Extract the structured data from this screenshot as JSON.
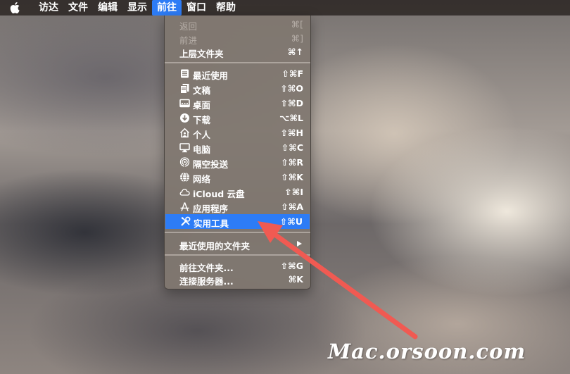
{
  "menubar": {
    "apple_icon": "apple-logo-icon",
    "items": [
      {
        "label": "访达"
      },
      {
        "label": "文件"
      },
      {
        "label": "编辑"
      },
      {
        "label": "显示"
      },
      {
        "label": "前往",
        "active": true
      },
      {
        "label": "窗口"
      },
      {
        "label": "帮助"
      }
    ]
  },
  "go_menu": {
    "back": {
      "label": "返回",
      "shortcut": "⌘["
    },
    "forward": {
      "label": "前进",
      "shortcut": "⌘]"
    },
    "enclosing": {
      "label": "上层文件夹",
      "shortcut": "⌘↑"
    },
    "recents": {
      "label": "最近使用",
      "shortcut": "⇧⌘F",
      "icon": "recents-icon"
    },
    "documents": {
      "label": "文稿",
      "shortcut": "⇧⌘O",
      "icon": "documents-icon"
    },
    "desktop": {
      "label": "桌面",
      "shortcut": "⇧⌘D",
      "icon": "desktop-icon"
    },
    "downloads": {
      "label": "下载",
      "shortcut": "⌥⌘L",
      "icon": "downloads-icon"
    },
    "home": {
      "label": "个人",
      "shortcut": "⇧⌘H",
      "icon": "home-icon"
    },
    "computer": {
      "label": "电脑",
      "shortcut": "⇧⌘C",
      "icon": "computer-icon"
    },
    "airdrop": {
      "label": "隔空投送",
      "shortcut": "⇧⌘R",
      "icon": "airdrop-icon"
    },
    "network": {
      "label": "网络",
      "shortcut": "⇧⌘K",
      "icon": "network-icon"
    },
    "icloud": {
      "label": "iCloud 云盘",
      "shortcut": "⇧⌘I",
      "icon": "cloud-icon"
    },
    "applications": {
      "label": "应用程序",
      "shortcut": "⇧⌘A",
      "icon": "applications-icon"
    },
    "utilities": {
      "label": "实用工具",
      "shortcut": "⇧⌘U",
      "icon": "utilities-icon",
      "highlighted": true
    },
    "recent_folders": {
      "label": "最近使用的文件夹"
    },
    "go_to_folder": {
      "label": "前往文件夹...",
      "shortcut": "⇧⌘G"
    },
    "connect_server": {
      "label": "连接服务器...",
      "shortcut": "⌘K"
    }
  },
  "watermark": {
    "text": "Mac.orsoon.com"
  },
  "colors": {
    "highlight": "#2d7cf6",
    "menu_bg": "#807770",
    "arrow": "#f05a52"
  }
}
